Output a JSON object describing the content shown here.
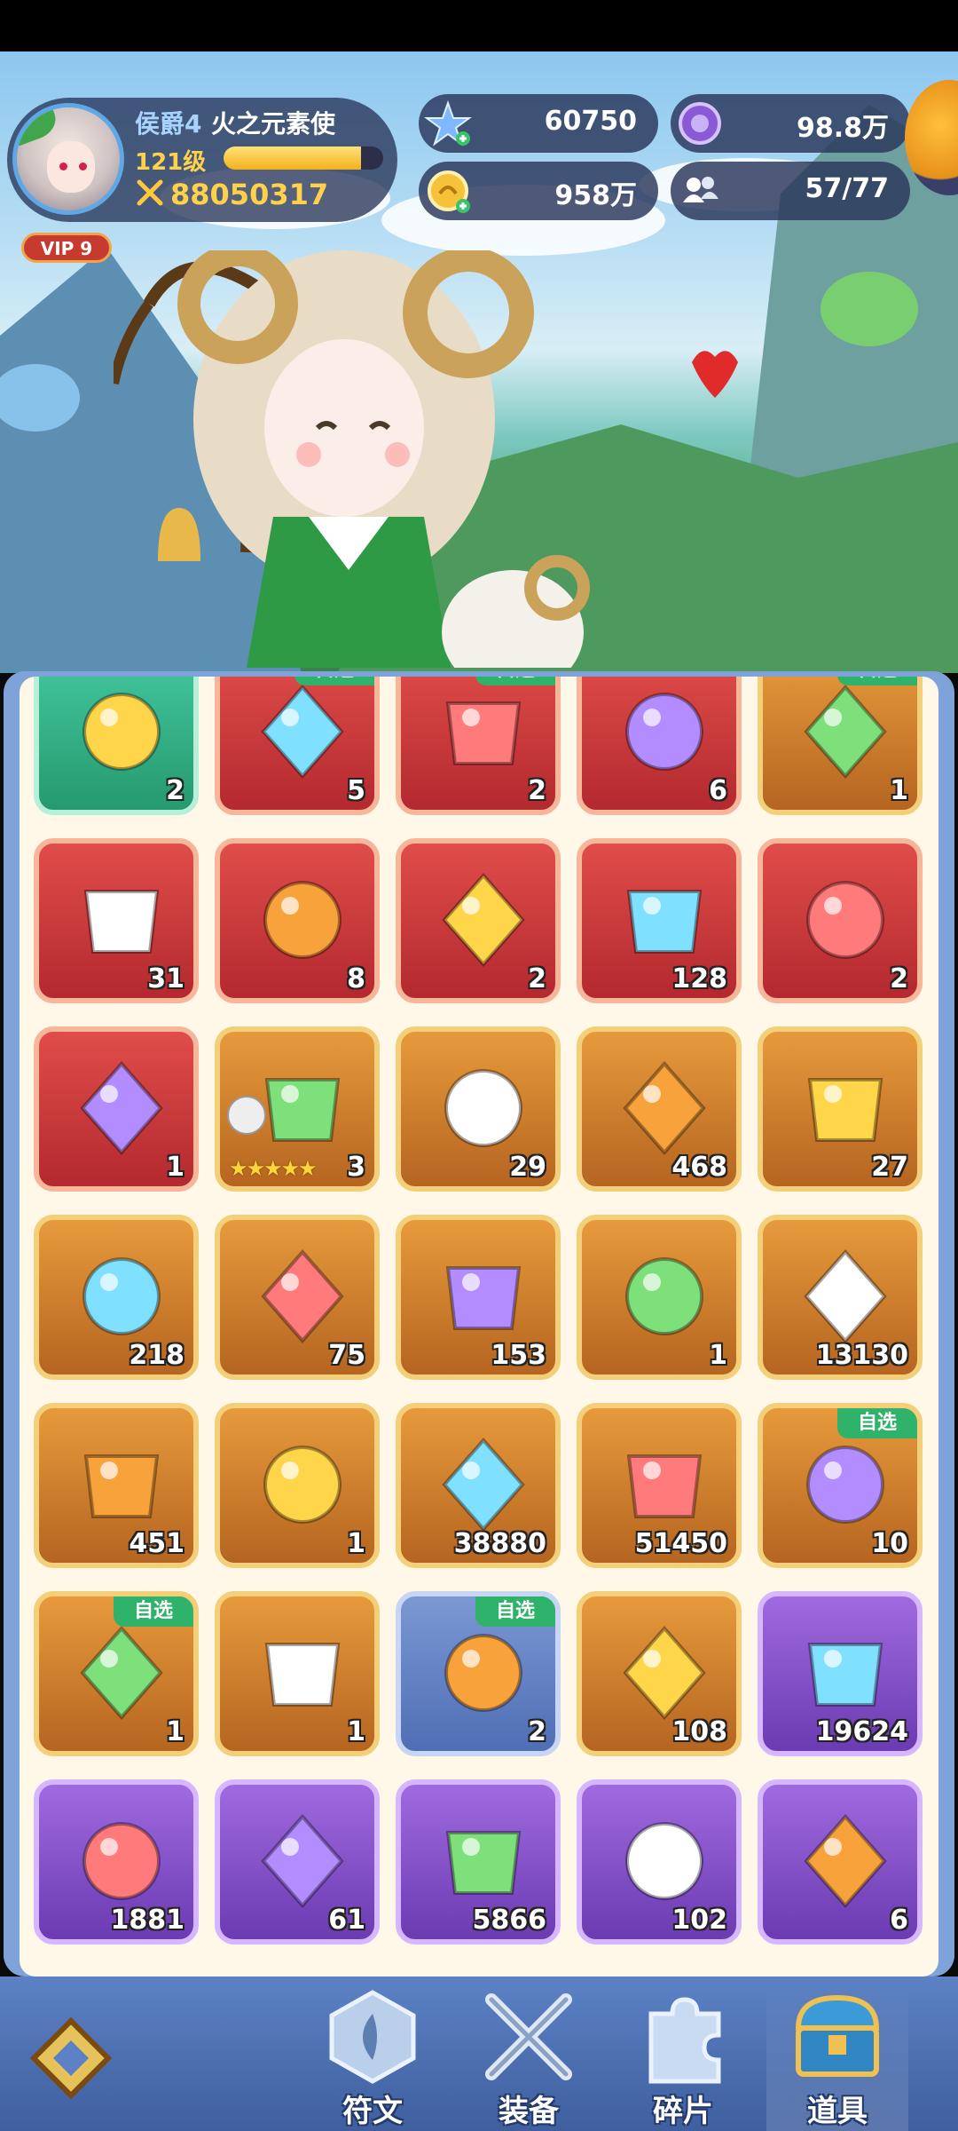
{
  "player": {
    "title": "侯爵4",
    "name": "火之元素使",
    "level": "121级",
    "exp_fraction": 0.86,
    "power": "88050317",
    "vip": "VIP 9"
  },
  "resources": [
    {
      "icon": "star-crystal-icon",
      "value": "60750"
    },
    {
      "icon": "purple-coin-icon",
      "value": "98.8万"
    },
    {
      "icon": "gold-coin-icon",
      "value": "958万"
    },
    {
      "icon": "friends-icon",
      "value": "57/77"
    }
  ],
  "items": [
    {
      "style": "teal",
      "icon": "rainbow-crystal-icon",
      "count": "2",
      "tag": ""
    },
    {
      "style": "red",
      "icon": "gift-egg-icon",
      "count": "5",
      "tag": "自选"
    },
    {
      "style": "red",
      "icon": "treasure-chest-icon",
      "count": "2",
      "tag": "自选"
    },
    {
      "style": "red",
      "icon": "mystery-chest-icon",
      "count": "6",
      "tag": ""
    },
    {
      "style": "gold",
      "icon": "gem-chest-icon",
      "count": "1",
      "tag": "自选"
    },
    {
      "style": "red",
      "icon": "lotus-flower-icon",
      "count": "31",
      "tag": ""
    },
    {
      "style": "red",
      "icon": "red-gem-icon",
      "count": "8",
      "tag": ""
    },
    {
      "style": "red",
      "icon": "blue-ticket-icon",
      "count": "2",
      "tag": ""
    },
    {
      "style": "red",
      "icon": "gold-ticket-icon",
      "count": "128",
      "tag": ""
    },
    {
      "style": "red",
      "icon": "fire-egg-icon",
      "count": "2",
      "tag": ""
    },
    {
      "style": "red",
      "icon": "wreath-icon",
      "count": "1",
      "tag": ""
    },
    {
      "style": "gold",
      "icon": "crystal-ball-icon",
      "count": "3",
      "tag": "",
      "stars": "★★★★★"
    },
    {
      "style": "gold",
      "icon": "coral-icon",
      "count": "29",
      "tag": ""
    },
    {
      "style": "gold",
      "icon": "summon-ticket-icon",
      "count": "468",
      "tag": ""
    },
    {
      "style": "gold",
      "icon": "blue-star-icon",
      "count": "27",
      "tag": ""
    },
    {
      "style": "gold",
      "icon": "green-gem-icon",
      "count": "218",
      "tag": ""
    },
    {
      "style": "gold",
      "icon": "heart-ticket-icon",
      "count": "75",
      "tag": ""
    },
    {
      "style": "gold",
      "icon": "rainbow-potion-icon",
      "count": "153",
      "tag": ""
    },
    {
      "style": "gold",
      "icon": "golden-key-icon",
      "count": "1",
      "tag": ""
    },
    {
      "style": "gold",
      "icon": "silver-coin-icon",
      "count": "13130",
      "tag": ""
    },
    {
      "style": "gold",
      "icon": "blue-potion-icon",
      "count": "451",
      "tag": ""
    },
    {
      "style": "gold",
      "icon": "swirl-stone-icon",
      "count": "1",
      "tag": ""
    },
    {
      "style": "gold",
      "icon": "gold-medal-icon",
      "count": "38880",
      "tag": ""
    },
    {
      "style": "gold",
      "icon": "purple-medal-icon",
      "count": "51450",
      "tag": ""
    },
    {
      "style": "gold",
      "icon": "pet-egg-icon",
      "count": "10",
      "tag": "自选"
    },
    {
      "style": "gold",
      "icon": "jewel-chest-icon",
      "count": "1",
      "tag": "自选"
    },
    {
      "style": "gold",
      "icon": "swap-potion-icon",
      "count": "1",
      "tag": ""
    },
    {
      "style": "blue",
      "icon": "ice-chest-icon",
      "count": "2",
      "tag": "自选"
    },
    {
      "style": "gold",
      "icon": "dragon-egg-icon",
      "count": "108",
      "tag": ""
    },
    {
      "style": "purple",
      "icon": "diamond-icon",
      "count": "19624",
      "tag": ""
    },
    {
      "style": "purple",
      "icon": "hourglass-icon",
      "count": "1881",
      "tag": ""
    },
    {
      "style": "purple",
      "icon": "ice-crystal-icon",
      "count": "61",
      "tag": ""
    },
    {
      "style": "purple",
      "icon": "purple-orb-icon",
      "count": "5866",
      "tag": ""
    },
    {
      "style": "purple",
      "icon": "sword-card-icon",
      "count": "102",
      "tag": ""
    },
    {
      "style": "purple",
      "icon": "refresh-card-icon",
      "count": "6",
      "tag": ""
    }
  ],
  "nav": {
    "tabs": [
      {
        "label": "符文",
        "icon": "rune-icon",
        "active": false
      },
      {
        "label": "装备",
        "icon": "crossed-swords-icon",
        "active": false
      },
      {
        "label": "碎片",
        "icon": "puzzle-piece-icon",
        "active": false
      },
      {
        "label": "道具",
        "icon": "treasure-chest-icon",
        "active": true
      }
    ]
  }
}
